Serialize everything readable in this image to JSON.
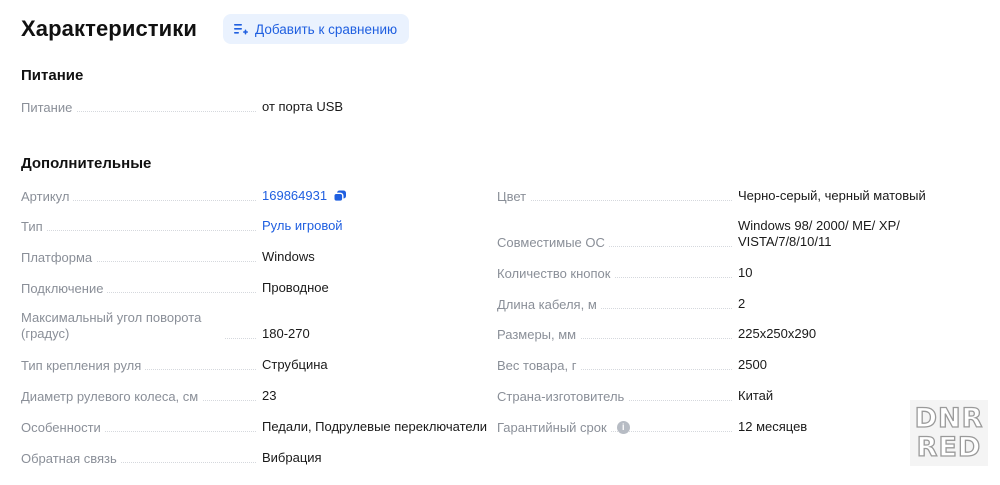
{
  "header": {
    "title": "Характеристики",
    "compare_label": "Добавить к сравнению"
  },
  "sections": {
    "power": {
      "title": "Питание",
      "rows": [
        {
          "label": "Питание",
          "value": "от порта USB"
        }
      ]
    },
    "extra": {
      "title": "Дополнительные",
      "left": [
        {
          "label": "Артикул",
          "value": "169864931"
        },
        {
          "label": "Тип",
          "value": "Руль игровой"
        },
        {
          "label": "Платформа",
          "value": "Windows"
        },
        {
          "label": "Подключение",
          "value": "Проводное"
        },
        {
          "label": "Максимальный угол поворота (градус)",
          "value": "180-270"
        },
        {
          "label": "Тип крепления руля",
          "value": "Струбцина"
        },
        {
          "label": "Диаметр рулевого колеса, см",
          "value": "23"
        },
        {
          "label": "Особенности",
          "value": "Педали, Подрулевые переключатели"
        },
        {
          "label": "Обратная связь",
          "value": "Вибрация"
        }
      ],
      "right": [
        {
          "label": "Цвет",
          "value": "Черно-серый, черный матовый"
        },
        {
          "label": "Совместимые ОС",
          "value": "Windows 98/ 2000/ ME/ XP/ VISTA/7/8/10/11"
        },
        {
          "label": "Количество кнопок",
          "value": "10"
        },
        {
          "label": "Длина кабеля, м",
          "value": "2"
        },
        {
          "label": "Размеры, мм",
          "value": "225x250x290"
        },
        {
          "label": "Вес товара, г",
          "value": "2500"
        },
        {
          "label": "Страна-изготовитель",
          "value": "Китай"
        },
        {
          "label": "Гарантийный срок",
          "value": "12 месяцев"
        }
      ]
    }
  },
  "watermark": {
    "line1": "DNR",
    "line2": "RED"
  },
  "colors": {
    "link": "#1f5fe0",
    "label": "#8a8f98",
    "button_bg": "#eaf2fe"
  }
}
